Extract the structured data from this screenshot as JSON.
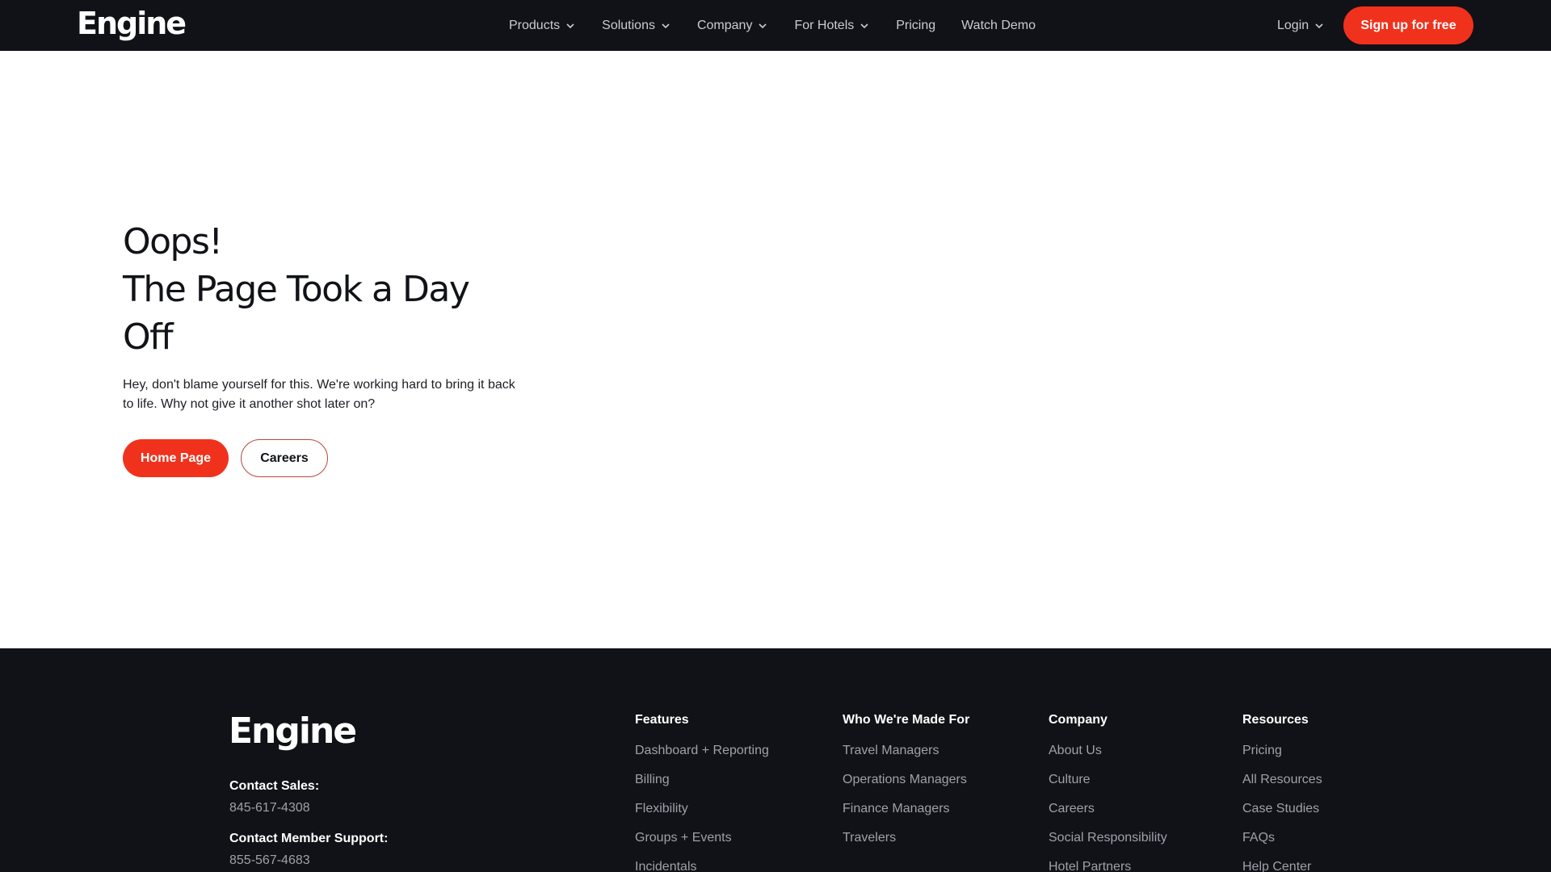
{
  "brand": {
    "name": "Engine",
    "accent": "#f0321d",
    "dark": "#111217"
  },
  "header": {
    "nav": [
      {
        "label": "Products",
        "dropdown": true
      },
      {
        "label": "Solutions",
        "dropdown": true
      },
      {
        "label": "Company",
        "dropdown": true
      },
      {
        "label": "For Hotels",
        "dropdown": true
      },
      {
        "label": "Pricing",
        "dropdown": false
      },
      {
        "label": "Watch Demo",
        "dropdown": false
      }
    ],
    "login_label": "Login",
    "signup_label": "Sign up for free"
  },
  "hero": {
    "title_line1": "Oops!",
    "title_line2": "The Page Took a Day",
    "title_line3": "Off",
    "body": "Hey, don't blame yourself for this. We're working hard to bring it back to life. Why not give it another shot later on?",
    "primary_label": "Home Page",
    "secondary_label": "Careers"
  },
  "footer": {
    "sales_label": "Contact Sales:",
    "sales_phone": "845-617-4308",
    "support_label": "Contact Member Support:",
    "support_phone": "855-567-4683",
    "columns": [
      {
        "title": "Features",
        "links": [
          "Dashboard + Reporting",
          "Billing",
          "Flexibility",
          "Groups + Events",
          "Incidentals"
        ]
      },
      {
        "title": "Who We're Made For",
        "links": [
          "Travel Managers",
          "Operations Managers",
          "Finance Managers",
          "Travelers"
        ]
      },
      {
        "title": "Company",
        "links": [
          "About Us",
          "Culture",
          "Careers",
          "Social Responsibility",
          "Hotel Partners"
        ]
      },
      {
        "title": "Resources",
        "links": [
          "Pricing",
          "All Resources",
          "Case Studies",
          "FAQs",
          "Help Center"
        ]
      }
    ]
  }
}
